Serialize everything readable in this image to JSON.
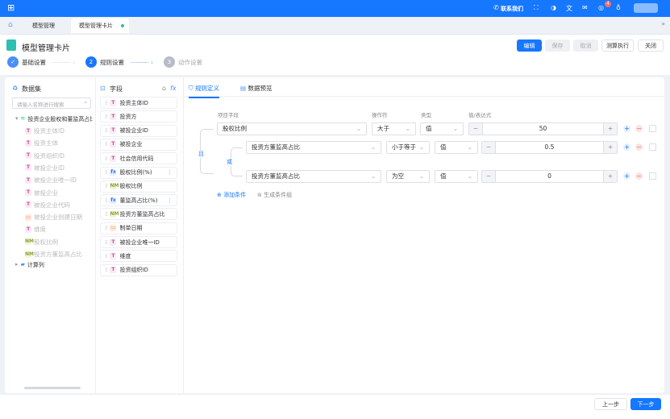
{
  "topbar": {
    "contact": "联系我们",
    "notification_count": "4",
    "icons": [
      "apps-icon",
      "phone-icon",
      "fullscreen-icon",
      "theme-icon",
      "translate-icon",
      "mail-icon",
      "task-icon",
      "bulb-icon"
    ]
  },
  "tabs": [
    {
      "label": "模型管理"
    },
    {
      "label": "模型管理卡片"
    }
  ],
  "page": {
    "title": "模型管理卡片"
  },
  "actions": {
    "edit": "编辑",
    "save": "保存",
    "cancel": "取消",
    "calc": "测算执行",
    "close": "关闭"
  },
  "steps": [
    {
      "num": "✓",
      "label": "基础设置"
    },
    {
      "num": "2",
      "label": "规则设置"
    },
    {
      "num": "3",
      "label": "动作设置"
    }
  ],
  "dataset": {
    "title": "数据集",
    "search_placeholder": "请输入名称进行搜索",
    "root": "投资企业股权和董监高占比",
    "items": [
      {
        "label": "投资主体ID",
        "type": "T"
      },
      {
        "label": "投资主体",
        "type": "T"
      },
      {
        "label": "投资组织ID",
        "type": "T"
      },
      {
        "label": "被投企业ID",
        "type": "T"
      },
      {
        "label": "被投企业唯一ID",
        "type": "T"
      },
      {
        "label": "被投企业",
        "type": "T"
      },
      {
        "label": "被投企业代码",
        "type": "T"
      },
      {
        "label": "被投企业创建日期",
        "type": "D"
      },
      {
        "label": "维度",
        "type": "T"
      },
      {
        "label": "股权比例",
        "type": "N"
      },
      {
        "label": "投资方董监高占比",
        "type": "N"
      }
    ],
    "calc_folder": "计算列"
  },
  "fields": {
    "title": "字段",
    "items": [
      {
        "label": "投资主体ID",
        "type": "T"
      },
      {
        "label": "投资方",
        "type": "T"
      },
      {
        "label": "被投企业ID",
        "type": "T"
      },
      {
        "label": "被投企业",
        "type": "T"
      },
      {
        "label": "社会信用代码",
        "type": "T"
      },
      {
        "label": "股权比例(%)",
        "type": "F"
      },
      {
        "label": "股权比例",
        "type": "N"
      },
      {
        "label": "董监高占比(%)",
        "type": "F"
      },
      {
        "label": "投资方董监高占比",
        "type": "N"
      },
      {
        "label": "制单日期",
        "type": "D"
      },
      {
        "label": "被投企业唯一ID",
        "type": "T"
      },
      {
        "label": "维度",
        "type": "T"
      },
      {
        "label": "投资组织ID",
        "type": "T"
      }
    ]
  },
  "rules": {
    "tabs": [
      {
        "label": "规则定义"
      },
      {
        "label": "数据预览"
      }
    ],
    "headers": {
      "field": "项目字段",
      "op": "操作符",
      "type": "类型",
      "value": "值/表达式"
    },
    "and_label": "且",
    "or_label": "或",
    "rows": [
      {
        "field": "股权比例",
        "op": "大于",
        "type": "值",
        "value": "50"
      },
      {
        "field": "投资方董监高占比",
        "op": "小于等于",
        "type": "值",
        "value": "0.5"
      },
      {
        "field": "投资方董监高占比",
        "op": "为空",
        "type": "值",
        "value": "0"
      }
    ],
    "add_condition": "添加条件",
    "gen_group": "生成条件组"
  },
  "footer": {
    "prev": "上一步",
    "next": "下一步"
  },
  "colors": {
    "primary": "#1677ff",
    "danger": "#f56c6c"
  }
}
